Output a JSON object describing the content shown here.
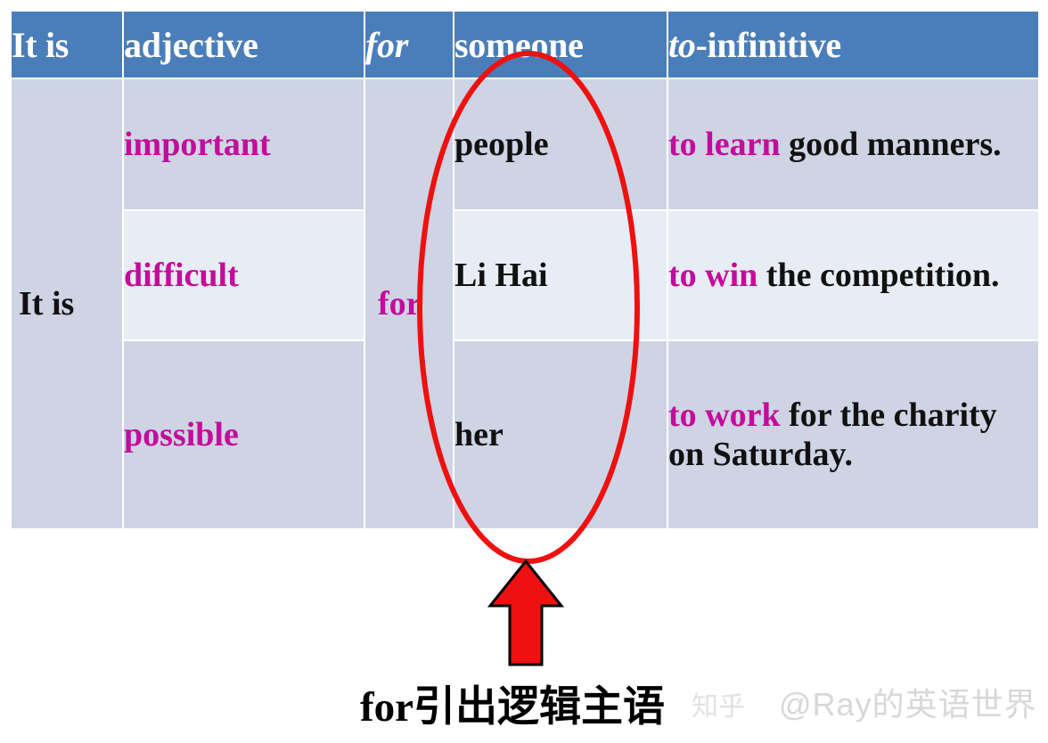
{
  "table": {
    "headers": [
      {
        "text": "It is",
        "italic_part": ""
      },
      {
        "text": "adjective",
        "italic_part": ""
      },
      {
        "text": "for",
        "italic_part": "for"
      },
      {
        "text": "someone",
        "italic_part": ""
      },
      {
        "text": "to-infinitive",
        "italic_part": "to"
      }
    ],
    "header_labels": {
      "h1": "It is",
      "h2": "adjective",
      "h3": "for",
      "h4": "someone",
      "h5_italic": "to",
      "h5_rest": "-infinitive"
    },
    "span_cells": {
      "it_is": "It is",
      "for": "for"
    },
    "rows": [
      {
        "adjective": "important",
        "someone": "people",
        "infinitive_verb": "to learn",
        "infinitive_rest": "good manners."
      },
      {
        "adjective": "difficult",
        "someone": "Li Hai",
        "infinitive_verb": "to win",
        "infinitive_rest": "the competition."
      },
      {
        "adjective": "possible",
        "someone": "her",
        "infinitive_verb": "to work",
        "infinitive_rest": "for the charity on Saturday."
      }
    ]
  },
  "annotation": {
    "caption": "for引出逻辑主语",
    "ellipse_name": "red-ellipse-highlight",
    "arrow_name": "red-up-arrow"
  },
  "watermark": {
    "handle": "@Ray的英语世界",
    "logo": "知乎"
  },
  "colors": {
    "header_blue": "#4a7ebb",
    "row_dark": "#ced4e4",
    "row_light": "#e8ecf4",
    "magenta": "#c50b9b",
    "annotation_red": "#ef1010",
    "text_black": "#111111",
    "watermark_gray": "#d8d8d8"
  }
}
